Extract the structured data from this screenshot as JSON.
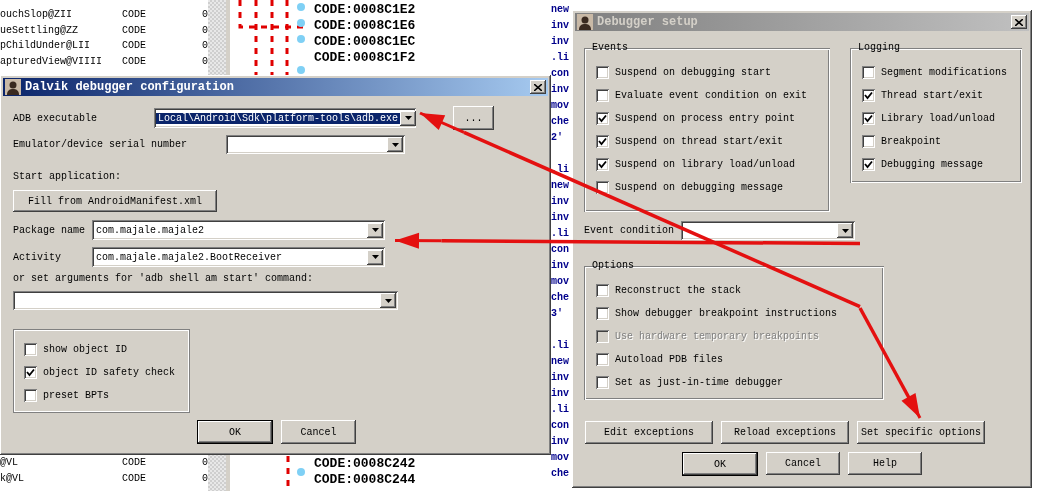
{
  "function_list": {
    "top_rows": [
      {
        "name": "ouchSlop@ZII",
        "segment": "CODE",
        "start": "0"
      },
      {
        "name": "ueSettling@ZZ",
        "segment": "CODE",
        "start": "0"
      },
      {
        "name": "pChildUnder@LII",
        "segment": "CODE",
        "start": "0"
      },
      {
        "name": "apturedView@VIIII",
        "segment": "CODE",
        "start": "0"
      }
    ],
    "bottom_rows": [
      {
        "name": "@VL",
        "segment": "CODE",
        "start": "0"
      },
      {
        "name": "k@VL",
        "segment": "CODE",
        "start": "0"
      }
    ]
  },
  "disassembly": {
    "top_addresses": [
      "CODE:0008C1E2",
      "CODE:0008C1E6",
      "CODE:0008C1EC",
      "CODE:0008C1F2"
    ],
    "bottom_addresses": [
      "CODE:0008C242",
      "CODE:0008C244"
    ],
    "instruction_blocks": [
      [
        "new",
        "inv",
        "inv",
        ".li",
        "con",
        "inv",
        "mov",
        "che",
        "2'"
      ],
      [
        ".li",
        "new",
        "inv",
        "inv",
        ".li",
        "con",
        "inv",
        "mov",
        "che",
        "3'"
      ],
      [
        ".li",
        "new",
        "inv",
        "inv",
        ".li",
        "con",
        "inv",
        "mov",
        "che"
      ]
    ]
  },
  "dalvik_dialog": {
    "title": "Dalvik debugger configuration",
    "active": true,
    "adb_executable": {
      "label": "ADB executable",
      "value": "Local\\Android\\Sdk\\platform-tools\\adb.exe",
      "highlighted": true
    },
    "browse_button": "...",
    "serial_number": {
      "label": "Emulator/device serial number"
    },
    "start_label": "Start application:",
    "fill_button": "Fill from AndroidManifest.xml",
    "package_name": {
      "label": "Package name",
      "value": "com.majale.majale2"
    },
    "activity": {
      "label": "Activity",
      "value": "com.majale.majale2.BootReceiver"
    },
    "arguments_label": "or set arguments for 'adb shell am start' command:",
    "checkboxes": [
      {
        "label": "show object ID",
        "checked": false
      },
      {
        "label": "object ID safety check",
        "checked": true
      },
      {
        "label": "preset BPTs",
        "checked": false
      }
    ],
    "buttons": [
      "OK",
      "Cancel"
    ]
  },
  "debugger_setup": {
    "title": "Debugger setup",
    "active": false,
    "events": {
      "title": "Events",
      "items": [
        {
          "label": "Suspend on debugging start",
          "checked": false
        },
        {
          "label": "Evaluate event condition on exit",
          "checked": false
        },
        {
          "label": "Suspend on process entry point",
          "checked": true
        },
        {
          "label": "Suspend on thread start/exit",
          "checked": true
        },
        {
          "label": "Suspend on library load/unload",
          "checked": true
        },
        {
          "label": "Suspend on debugging message",
          "checked": false
        }
      ]
    },
    "logging": {
      "title": "Logging",
      "items": [
        {
          "label": "Segment modifications",
          "checked": false
        },
        {
          "label": "Thread start/exit",
          "checked": true
        },
        {
          "label": "Library load/unload",
          "checked": true
        },
        {
          "label": "Breakpoint",
          "checked": false
        },
        {
          "label": "Debugging message",
          "checked": true
        }
      ]
    },
    "event_condition_label": "Event condition",
    "options": {
      "title": "Options",
      "items": [
        {
          "label": "Reconstruct the stack",
          "checked": false,
          "disabled": false
        },
        {
          "label": "Show debugger breakpoint instructions",
          "checked": false,
          "disabled": false
        },
        {
          "label": "Use hardware temporary breakpoints",
          "checked": false,
          "disabled": true
        },
        {
          "label": "Autoload PDB files",
          "checked": false,
          "disabled": false
        },
        {
          "label": "Set as just-in-time debugger",
          "checked": false,
          "disabled": false
        }
      ]
    },
    "action_buttons": [
      "Edit exceptions",
      "Reload exceptions",
      "Set specific options"
    ],
    "buttons": [
      "OK",
      "Cancel",
      "Help"
    ]
  }
}
